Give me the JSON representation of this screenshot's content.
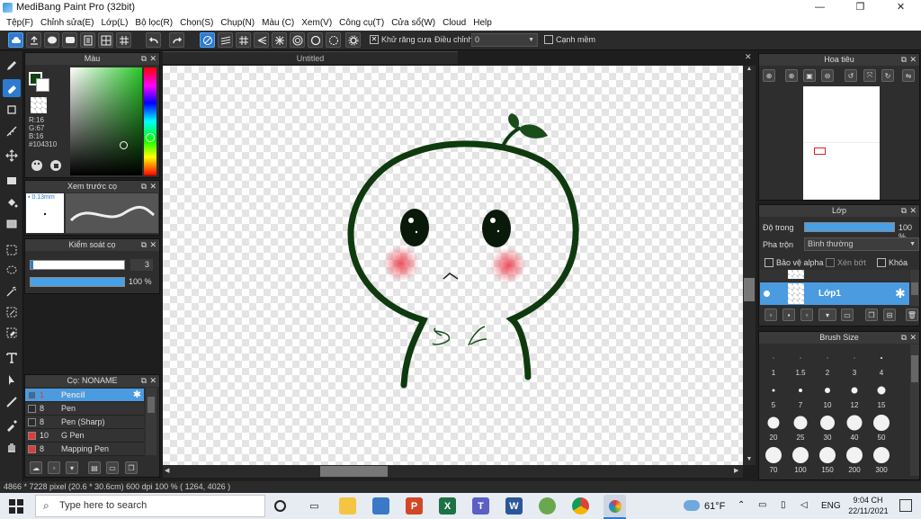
{
  "window": {
    "title": "MediBang Paint Pro (32bit)",
    "minimize": "—",
    "maximize": "❐",
    "close": "✕"
  },
  "menu": [
    "Tệp(F)",
    "Chỉnh sửa(E)",
    "Lớp(L)",
    "Bộ lọc(R)",
    "Chọn(S)",
    "Chụp(N)",
    "Màu (C)",
    "Xem(V)",
    "Công cụ(T)",
    "Cửa sổ(W)",
    "Cloud",
    "Help"
  ],
  "toolbar": {
    "antialias_label": "Khử răng cưa",
    "antialias_checked": true,
    "adjust_label": "Điều chỉnh",
    "adjust_value": "0",
    "smooth_label": "Cạnh mềm",
    "smooth_checked": false
  },
  "document": {
    "tab_title": "Untitled"
  },
  "color_panel": {
    "title": "Màu",
    "r": "R:16",
    "g": "G:67",
    "b": "B:16",
    "hex": "#104310",
    "fg_color": "#104310",
    "bg_color": "#ffffff"
  },
  "preview_panel": {
    "title": "Xem trước cọ",
    "size": "0.13mm"
  },
  "brush_control": {
    "title": "Kiểm soát cọ",
    "size": "3",
    "opacity": "100 %",
    "opacity_value": 1.0
  },
  "brush_panel": {
    "title": "Cọ: NONAME",
    "brushes": [
      {
        "size": "1",
        "name": "Pencil",
        "color": "#2c6fb3",
        "selected": true
      },
      {
        "size": "8",
        "name": "Pen",
        "color": "#2a2a2a",
        "selected": false
      },
      {
        "size": "8",
        "name": "Pen (Sharp)",
        "color": "#2a2a2a",
        "selected": false
      },
      {
        "size": "10",
        "name": "G Pen",
        "color": "#e53935",
        "selected": false
      },
      {
        "size": "8",
        "name": "Mapping Pen",
        "color": "#e53935",
        "selected": false
      }
    ]
  },
  "navigator": {
    "title": "Hoa tiêu"
  },
  "layer_panel": {
    "title": "Lớp",
    "opacity_label": "Độ trong",
    "opacity": "100 %",
    "opacity_value": 1.0,
    "blend_label": "Pha trộn",
    "blend_value": "Bình thường",
    "protect_alpha": "Bảo vệ alpha",
    "clipping": "Xén bớt",
    "lock": "Khóa",
    "layer_name": "Lớp1"
  },
  "brush_size_panel": {
    "title": "Brush Size",
    "sizes": [
      "1",
      "1.5",
      "2",
      "3",
      "4",
      "5",
      "7",
      "10",
      "12",
      "15",
      "20",
      "25",
      "30",
      "40",
      "50",
      "70",
      "100",
      "150",
      "200",
      "300"
    ]
  },
  "status": "4866 * 7228 pixel  (20.6 * 30.6cm)  600 dpi  100 %  ( 1264, 4026 )",
  "taskbar": {
    "search_placeholder": "Type here to search",
    "weather": "61°F",
    "lang": "ENG",
    "time": "9:04 CH",
    "date": "22/11/2021"
  }
}
